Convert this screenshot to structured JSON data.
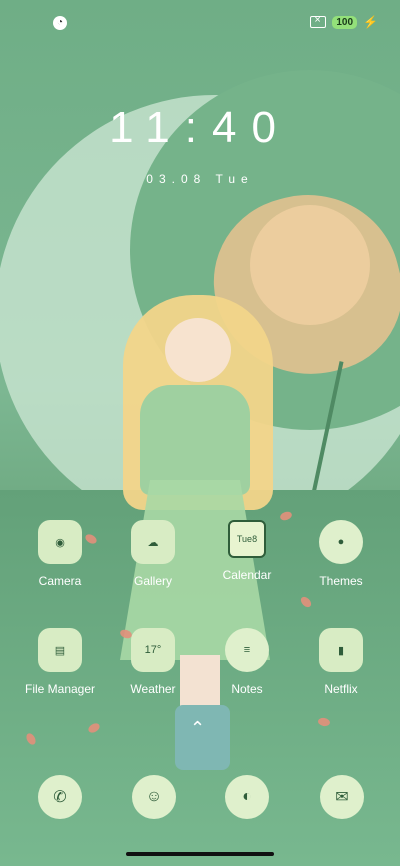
{
  "status": {
    "battery": "100",
    "charging_icon": "charging-bolt-icon",
    "sim_icon": "no-sim-icon",
    "left_icon": "notification-icon"
  },
  "lockscreen": {
    "time": "11:40",
    "date": "03.08 Tue"
  },
  "apps": [
    {
      "label": "Camera",
      "icon": "camera-icon"
    },
    {
      "label": "Gallery",
      "icon": "gallery-icon"
    },
    {
      "label": "Calendar",
      "icon": "calendar-icon",
      "day": "Tue",
      "date": "8"
    },
    {
      "label": "Themes",
      "icon": "palette-icon"
    },
    {
      "label": "File Manager",
      "icon": "folder-icon"
    },
    {
      "label": "Weather",
      "icon": "weather-icon",
      "temp": "17°"
    },
    {
      "label": "Notes",
      "icon": "notes-icon"
    },
    {
      "label": "Netflix",
      "icon": "netflix-icon"
    }
  ],
  "dock": [
    {
      "icon": "phone-icon"
    },
    {
      "icon": "contacts-icon"
    },
    {
      "icon": "browser-icon"
    },
    {
      "icon": "messages-icon"
    }
  ],
  "colors": {
    "background": "#75b38a",
    "icon_fill": "#dff0cc",
    "icon_ink": "#2f5d3a",
    "battery": "#93e07a"
  }
}
